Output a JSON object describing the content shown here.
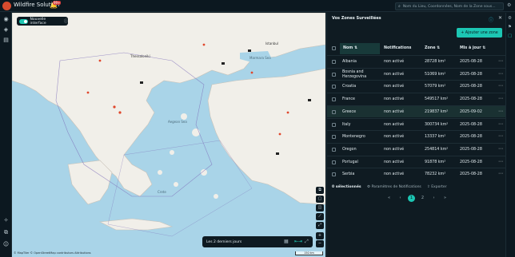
{
  "app": {
    "name": "Wildfire Solution",
    "notification_badge": "99+"
  },
  "search": {
    "placeholder": "Nom du Lieu, Coordonnées, Nom de la Zone sous..."
  },
  "map": {
    "toggle_label": "Nouvelle interface",
    "time_range_label": "Les 2 derniers jours",
    "attribution": "© MapTiler © OpenStreetMap contributors Attributions",
    "scale_label": "150 km",
    "labels": [
      {
        "text": "Marmara Sea",
        "kind": "sea"
      },
      {
        "text": "Istanbul",
        "kind": "city"
      },
      {
        "text": "Aegean Sea",
        "kind": "sea"
      },
      {
        "text": "Crete",
        "kind": "island"
      },
      {
        "text": "Thessaloniki",
        "kind": "city"
      }
    ]
  },
  "panel": {
    "title": "Vos Zones Surveillées",
    "add_button": "+ Ajouter une zone",
    "columns": {
      "name": "Nom",
      "notifications": "Notifications",
      "zone": "Zone",
      "updated": "Mis à jour"
    },
    "rows": [
      {
        "name": "Albania",
        "notifications": "non activé",
        "zone": "28728 km²",
        "updated": "2025-08-28",
        "selected": false
      },
      {
        "name": "Bosnia and Herzegovina",
        "notifications": "non activé",
        "zone": "51069 km²",
        "updated": "2025-08-28",
        "selected": false
      },
      {
        "name": "Croatia",
        "notifications": "non activé",
        "zone": "57079 km²",
        "updated": "2025-08-28",
        "selected": false
      },
      {
        "name": "France",
        "notifications": "non activé",
        "zone": "549517 km²",
        "updated": "2025-08-28",
        "selected": false
      },
      {
        "name": "Greece",
        "notifications": "non activé",
        "zone": "219837 km²",
        "updated": "2025-09-02",
        "selected": true
      },
      {
        "name": "Italy",
        "notifications": "non activé",
        "zone": "300734 km²",
        "updated": "2025-08-28",
        "selected": false
      },
      {
        "name": "Montenegro",
        "notifications": "non activé",
        "zone": "13337 km²",
        "updated": "2025-08-28",
        "selected": false
      },
      {
        "name": "Oregon",
        "notifications": "non activé",
        "zone": "254814 km²",
        "updated": "2025-08-28",
        "selected": false
      },
      {
        "name": "Portugal",
        "notifications": "non activé",
        "zone": "91878 km²",
        "updated": "2025-08-28",
        "selected": false
      },
      {
        "name": "Serbia",
        "notifications": "non activé",
        "zone": "78232 km²",
        "updated": "2025-08-28",
        "selected": false
      }
    ],
    "footer": {
      "selected_count": "0 sélectionnés",
      "notif_settings": "Paramètres de Notifications",
      "export": "Exporter"
    },
    "pager": {
      "pages": [
        "1",
        "2"
      ],
      "current": "1"
    }
  },
  "colors": {
    "accent": "#1cc6b3",
    "panel_bg": "#0f1b22",
    "water": "#a9d4e8",
    "land": "#f1efe9"
  }
}
